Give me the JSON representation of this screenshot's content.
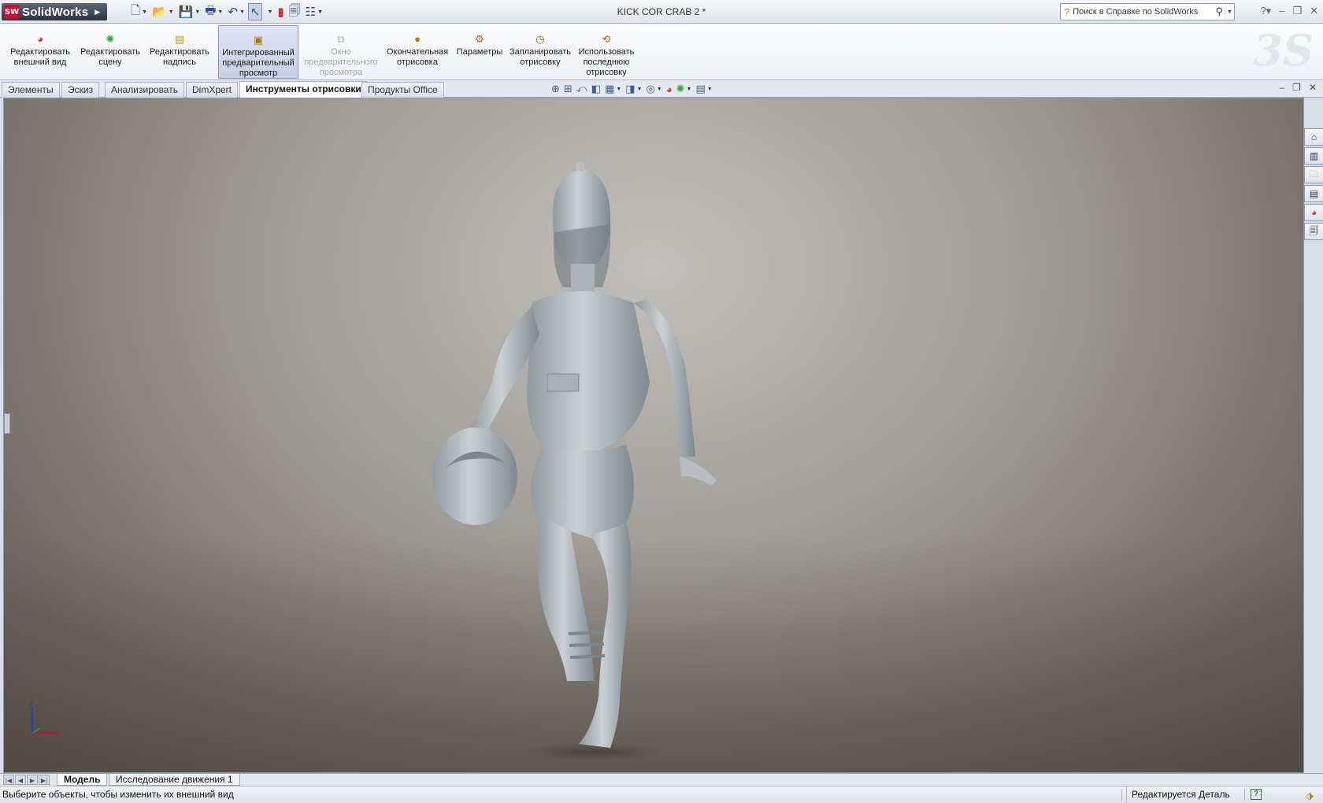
{
  "app": {
    "logo_text": "SolidWorks",
    "logo_mark": "SW",
    "document_title": "KICK COR CRAB 2 *"
  },
  "help_search": {
    "placeholder": "Поиск в Справке по SolidWorks"
  },
  "ribbon": {
    "buttons": [
      {
        "label_1": "Редактировать",
        "label_2": "внешний вид",
        "label_3": "",
        "icon": "appearance-icon"
      },
      {
        "label_1": "Редактировать",
        "label_2": "сцену",
        "label_3": "",
        "icon": "scene-icon"
      },
      {
        "label_1": "Редактировать",
        "label_2": "надпись",
        "label_3": "",
        "icon": "decal-icon"
      },
      {
        "label_1": "Интегрированный",
        "label_2": "предварительный",
        "label_3": "просмотр",
        "icon": "integrated-preview-icon",
        "active": true
      },
      {
        "label_1": "Окно",
        "label_2": "предварительного",
        "label_3": "просмотра",
        "icon": "preview-window-icon",
        "disabled": true
      },
      {
        "label_1": "Окончательная",
        "label_2": "отрисовка",
        "label_3": "",
        "icon": "final-render-icon"
      },
      {
        "label_1": "Параметры",
        "label_2": "",
        "label_3": "",
        "icon": "options-icon"
      },
      {
        "label_1": "Запланировать",
        "label_2": "отрисовку",
        "label_3": "",
        "icon": "schedule-render-icon"
      },
      {
        "label_1": "Использовать",
        "label_2": "последнюю",
        "label_3": "отрисовку",
        "icon": "recall-render-icon"
      }
    ]
  },
  "tabs": [
    {
      "label": "Элементы"
    },
    {
      "label": "Эскиз"
    },
    {
      "label": "Анализировать"
    },
    {
      "label": "DimXpert"
    },
    {
      "label": "Инструменты отрисовки",
      "active": true
    },
    {
      "label": "Продукты Office"
    }
  ],
  "bottom_tabs": [
    {
      "label": "Модель",
      "active": true
    },
    {
      "label": "Исследование движения 1"
    }
  ],
  "status": {
    "hint": "Выберите объекты, чтобы изменить их внешний вид",
    "mode": "Редактируется Деталь",
    "help_glyph": "?"
  },
  "triad": {
    "z_label": "Z",
    "x_label": "X"
  },
  "colors": {
    "accent": "#2b4f8a",
    "logo_red": "#c8102e",
    "model_gray": "#b9c2c6"
  }
}
